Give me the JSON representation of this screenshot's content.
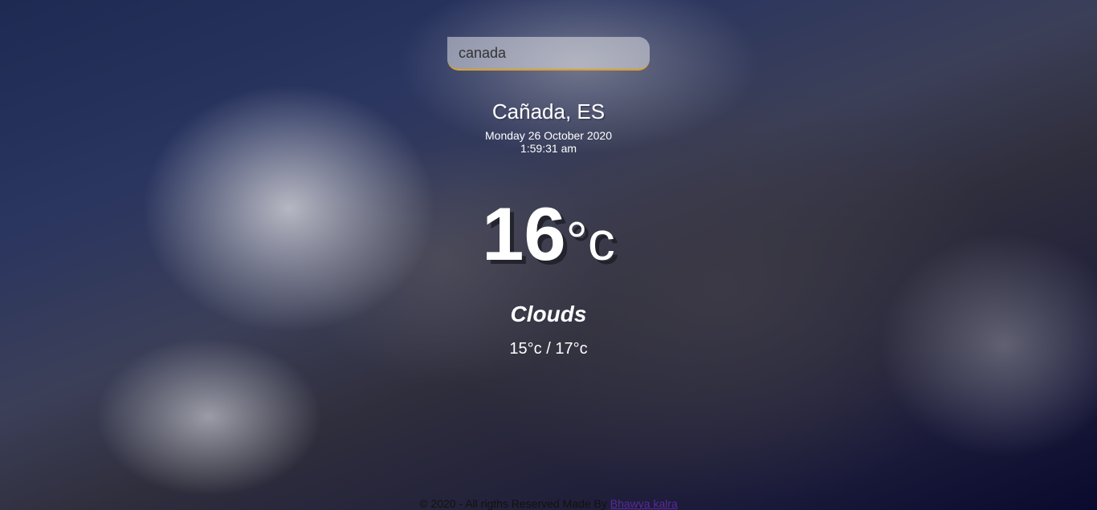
{
  "search": {
    "value": "canada"
  },
  "location": "Cañada, ES",
  "date": "Monday 26 October 2020",
  "time": "1:59:31 am",
  "temperature": {
    "value": "16",
    "unit": "°c"
  },
  "condition": "Clouds",
  "hilo": "15°c / 17°c",
  "footer": {
    "text": "© 2020 - All rigths Reserved Made By ",
    "link_label": "Bhawya kalra"
  },
  "colors": {
    "accent": "#e0a020",
    "text": "#ffffff",
    "link": "#5a2a9a"
  }
}
